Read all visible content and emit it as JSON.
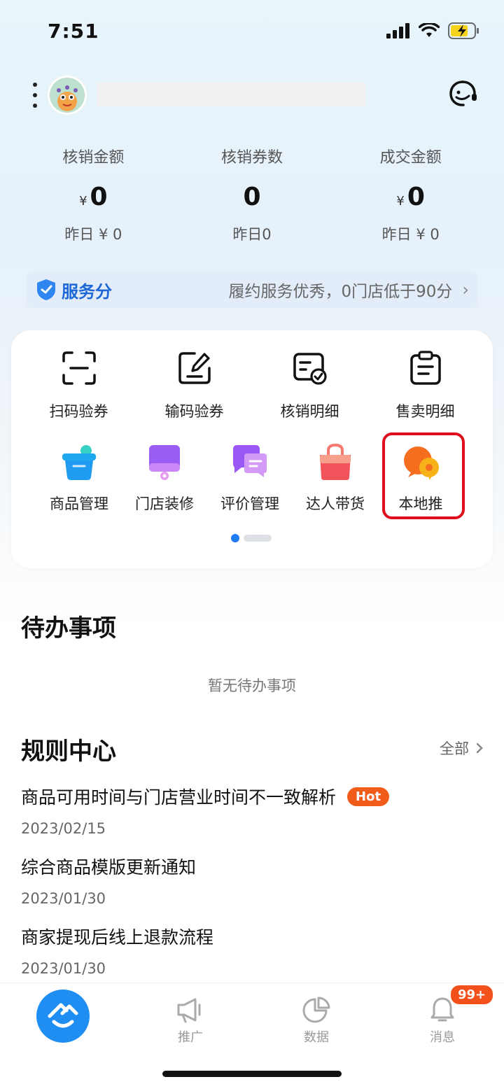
{
  "status_bar": {
    "time": "7:51"
  },
  "header": {
    "avatar": "avatar-monster",
    "support_icon": "customer-service-icon"
  },
  "stats": [
    {
      "label": "核销金额",
      "currency": "¥",
      "value": "0",
      "yesterday": "昨日 ¥ 0"
    },
    {
      "label": "核销券数",
      "currency": "",
      "value": "0",
      "yesterday": "昨日0"
    },
    {
      "label": "成交金额",
      "currency": "¥",
      "value": "0",
      "yesterday": "昨日 ¥ 0"
    }
  ],
  "service": {
    "label": "服务分",
    "text": "履约服务优秀，0门店低于90分",
    "chevron": "›"
  },
  "tools_row1": [
    {
      "label": "扫码验券",
      "icon": "scan-icon"
    },
    {
      "label": "输码验券",
      "icon": "edit-code-icon"
    },
    {
      "label": "核销明细",
      "icon": "redeem-detail-icon"
    },
    {
      "label": "售卖明细",
      "icon": "clipboard-icon"
    }
  ],
  "tools_row2": [
    {
      "label": "商品管理",
      "icon": "basket-icon",
      "color": "#1ea8f0"
    },
    {
      "label": "门店装修",
      "icon": "store-decoration-icon",
      "color": "#9c5cf2"
    },
    {
      "label": "评价管理",
      "icon": "chat-bubbles-icon",
      "color": "#a55af5"
    },
    {
      "label": "达人带货",
      "icon": "shopping-bag-icon",
      "color": "#f2545b"
    },
    {
      "label": "本地推",
      "icon": "location-pin-icon",
      "color": "#f78a1d"
    }
  ],
  "todo": {
    "title": "待办事项",
    "empty": "暂无待办事项"
  },
  "rules": {
    "title": "规则中心",
    "all_label": "全部",
    "items": [
      {
        "title": "商品可用时间与门店营业时间不一致解析",
        "date": "2023/02/15",
        "badge": "Hot"
      },
      {
        "title": "综合商品模版更新通知",
        "date": "2023/01/30"
      },
      {
        "title": "商家提现后线上退款流程",
        "date": "2023/01/30"
      }
    ]
  },
  "tabbar": {
    "items": [
      {
        "label": "",
        "icon": "home-logo-icon"
      },
      {
        "label": "推广",
        "icon": "megaphone-icon"
      },
      {
        "label": "数据",
        "icon": "pie-chart-icon"
      },
      {
        "label": "消息",
        "icon": "bell-icon"
      }
    ],
    "badge": "99+"
  },
  "colors": {
    "accent": "#1f7cf5",
    "highlight": "#e00d1c",
    "hot": "#f25c1b"
  }
}
